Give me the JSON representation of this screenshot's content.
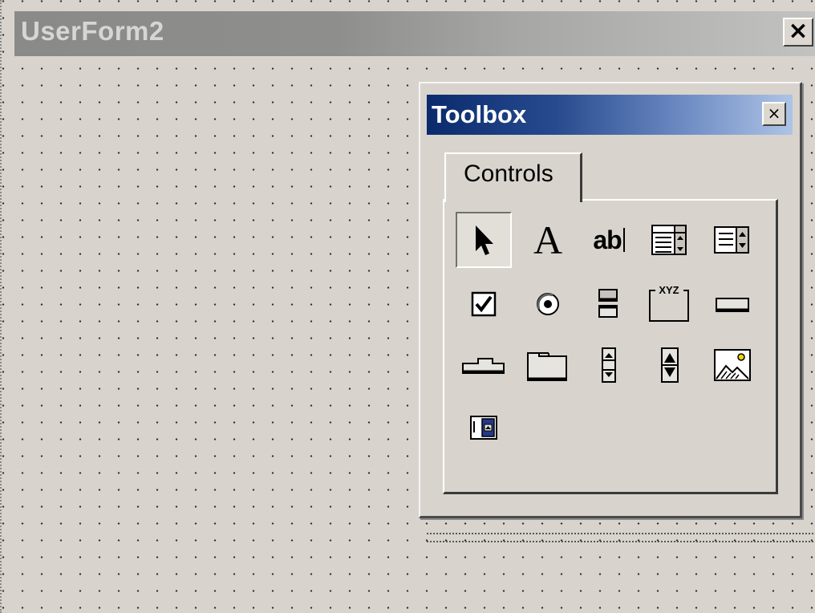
{
  "userform": {
    "title": "UserForm2",
    "close_label": "×"
  },
  "toolbox": {
    "title": "Toolbox",
    "close_label": "×",
    "tabs": [
      {
        "label": "Controls"
      }
    ],
    "controls": [
      {
        "name": "select-objects",
        "icon": "arrow-pointer-icon"
      },
      {
        "name": "label",
        "icon": "label-icon",
        "glyph": "A"
      },
      {
        "name": "textbox",
        "icon": "textbox-icon",
        "glyph": "ab"
      },
      {
        "name": "combobox",
        "icon": "combobox-icon"
      },
      {
        "name": "listbox",
        "icon": "listbox-icon"
      },
      {
        "name": "checkbox",
        "icon": "checkbox-icon"
      },
      {
        "name": "optionbutton",
        "icon": "option-button-icon"
      },
      {
        "name": "togglebutton",
        "icon": "toggle-button-icon"
      },
      {
        "name": "frame",
        "icon": "frame-icon",
        "glyph": "XYZ"
      },
      {
        "name": "commandbutton",
        "icon": "command-button-icon"
      },
      {
        "name": "tabstrip",
        "icon": "tabstrip-icon"
      },
      {
        "name": "multipage",
        "icon": "multipage-icon"
      },
      {
        "name": "scrollbar",
        "icon": "scrollbar-icon"
      },
      {
        "name": "spinbutton",
        "icon": "spin-button-icon"
      },
      {
        "name": "image",
        "icon": "image-icon"
      },
      {
        "name": "refedit",
        "icon": "refedit-icon"
      }
    ]
  }
}
